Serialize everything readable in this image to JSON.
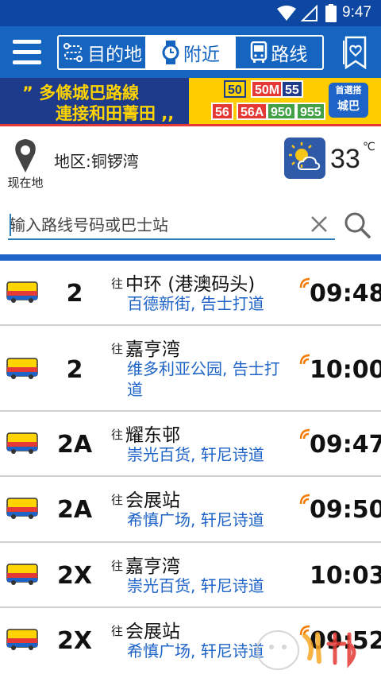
{
  "status_bar": {
    "time": "9:47"
  },
  "tabs": [
    {
      "label": "目的地",
      "icon": "route-icon"
    },
    {
      "label": "附近",
      "icon": "watch-icon"
    },
    {
      "label": "路线",
      "icon": "bus-front-icon"
    }
  ],
  "banner": {
    "line1": "” 多條城巴路線",
    "line2": "連接和田菁田 ,,",
    "routes": [
      "50",
      "50M",
      "55",
      "56",
      "56A",
      "950",
      "955"
    ],
    "logo_line1": "首選搭",
    "logo_line2": "城巴"
  },
  "location": {
    "label": "现在地",
    "district": "地区:铜锣湾",
    "temperature": "33",
    "temp_unit": "℃"
  },
  "search": {
    "placeholder": "输入路线号码或巴士站",
    "value": ""
  },
  "to_prefix": "往",
  "routes_list": [
    {
      "route": "2",
      "destination": "中环 (港澳码头)",
      "via": "百德新街, 告士打道",
      "eta": "09:48"
    },
    {
      "route": "2",
      "destination": "嘉亨湾",
      "via": "维多利亚公园, 告士打道",
      "eta": "10:00"
    },
    {
      "route": "2A",
      "destination": "耀东邨",
      "via": "崇光百货, 轩尼诗道",
      "eta": "09:47"
    },
    {
      "route": "2A",
      "destination": "会展站",
      "via": "希慎广场, 轩尼诗道",
      "eta": "09:50"
    },
    {
      "route": "2X",
      "destination": "嘉亨湾",
      "via": "崇光百货, 轩尼诗道",
      "eta": "10:03"
    },
    {
      "route": "2X",
      "destination": "会展站",
      "via": "希慎广场, 轩尼诗道",
      "eta": "09:52"
    }
  ],
  "colors": {
    "primary": "#1565c0",
    "accent_blue": "#1e63c7",
    "realtime_orange": "#f57c00"
  }
}
